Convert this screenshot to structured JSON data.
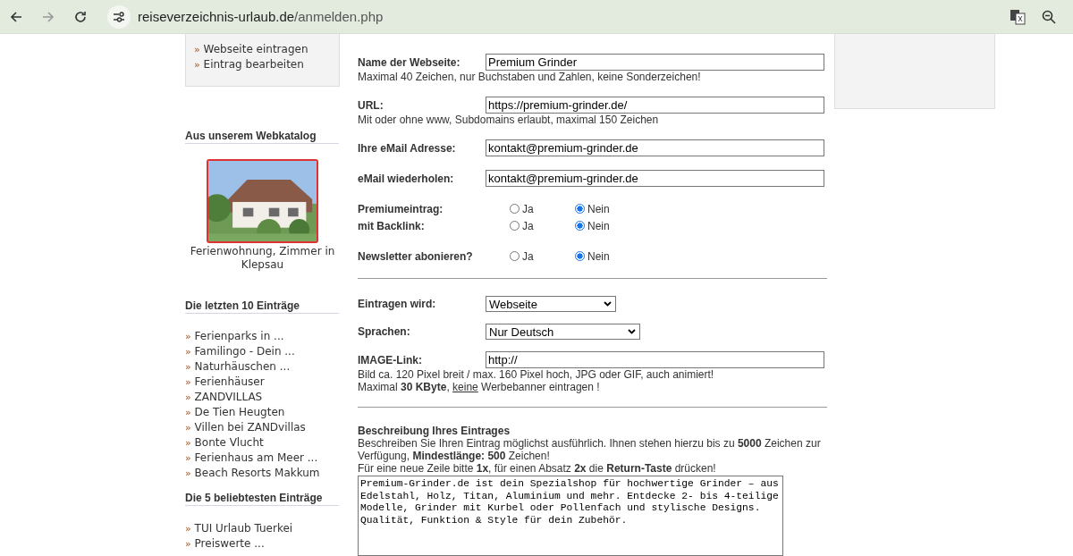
{
  "browser": {
    "url_host": "reiseverzeichnis-urlaub.de",
    "url_path": "/anmelden.php"
  },
  "sidebar": {
    "bullet": "»",
    "menu": [
      "Webseite eintragen",
      "Eintrag bearbeiten"
    ],
    "catalog": {
      "heading": "Aus unserem Webkatalog",
      "caption": "Ferienwohnung, Zimmer in Klepsau"
    },
    "recent": {
      "heading": "Die letzten 10 Einträge",
      "items": [
        "Ferienparks in ...",
        "Familingo - Dein ...",
        "Naturhäuschen ...",
        "Ferienhäuser",
        "ZANDVILLAS",
        "De Tien Heugten",
        "Villen bei ZANDvillas",
        "Bonte Vlucht",
        "Ferienhaus am Meer ...",
        "Beach Resorts Makkum"
      ]
    },
    "popular": {
      "heading": "Die 5 beliebtesten Einträge",
      "items": [
        "TUI Urlaub Tuerkei",
        "Preiswerte ..."
      ]
    }
  },
  "form": {
    "blocks": [
      {
        "kind": "text",
        "label": "Name der Webseite:",
        "value": "Premium Grinder",
        "hints": [
          "Maximal 40 Zeichen, nur Buchstaben und Zahlen, keine Sonderzeichen!"
        ]
      },
      {
        "kind": "text",
        "label": "URL:",
        "value": "https://premium-grinder.de/",
        "hints": [
          "Mit oder ohne www, Subdomains erlaubt, maximal 150 Zeichen"
        ]
      },
      {
        "kind": "text",
        "label": "Ihre eMail Adresse:",
        "value": "kontakt@premium-grinder.de"
      },
      {
        "kind": "text",
        "label": "eMail wiederholen:",
        "value": "kontakt@premium-grinder.de"
      },
      {
        "kind": "radios",
        "rows": [
          {
            "label": "Premiumeintrag:",
            "options": [
              {
                "label": "Ja",
                "selected": false
              },
              {
                "label": "Nein",
                "selected": true
              }
            ]
          },
          {
            "label": "mit Backlink:",
            "options": [
              {
                "label": "Ja",
                "selected": false
              },
              {
                "label": "Nein",
                "selected": true
              }
            ]
          }
        ]
      },
      {
        "kind": "radios",
        "rows": [
          {
            "label": "Newsletter abonieren?",
            "options": [
              {
                "label": "Ja",
                "selected": false
              },
              {
                "label": "Nein",
                "selected": true
              }
            ]
          }
        ]
      },
      {
        "kind": "divider"
      },
      {
        "kind": "select",
        "label": "Eintragen wird:",
        "value": "Webseite"
      },
      {
        "kind": "select",
        "label": "Sprachen:",
        "value": "Nur Deutsch"
      },
      {
        "kind": "text",
        "label": "IMAGE-Link:",
        "value": "http://",
        "hints": [
          "Bild ca. 120 Pixel breit / max. 160 Pixel hoch, JPG oder GIF, auch animiert!"
        ],
        "note": {
          "before": "Maximal **30 KByte**, ",
          "link": "keine",
          "after": " Werbebanner eintragen !"
        }
      },
      {
        "kind": "divider"
      },
      {
        "kind": "textarea",
        "label": "Beschreibung Ihres Eintrages",
        "hints": [
          "Beschreiben Sie Ihren Eintrag möglichst ausführlich. Ihnen stehen hierzu bis zu **5000** Zeichen zur Verfügung, **Mindestlänge: 500** Zeichen!",
          "Für eine neue Zeile bitte **1x**, für einen Absatz **2x** die **Return-Taste** drücken!"
        ],
        "value": "Premium-Grinder.de ist dein Spezialshop für hochwertige Grinder – aus Edelstahl, Holz, Titan, Aluminium und mehr. Entdecke 2- bis 4-teilige Modelle, Grinder mit Kurbel oder Pollenfach und stylische Designs. Qualität, Funktion & Style für dein Zubehör."
      }
    ]
  }
}
